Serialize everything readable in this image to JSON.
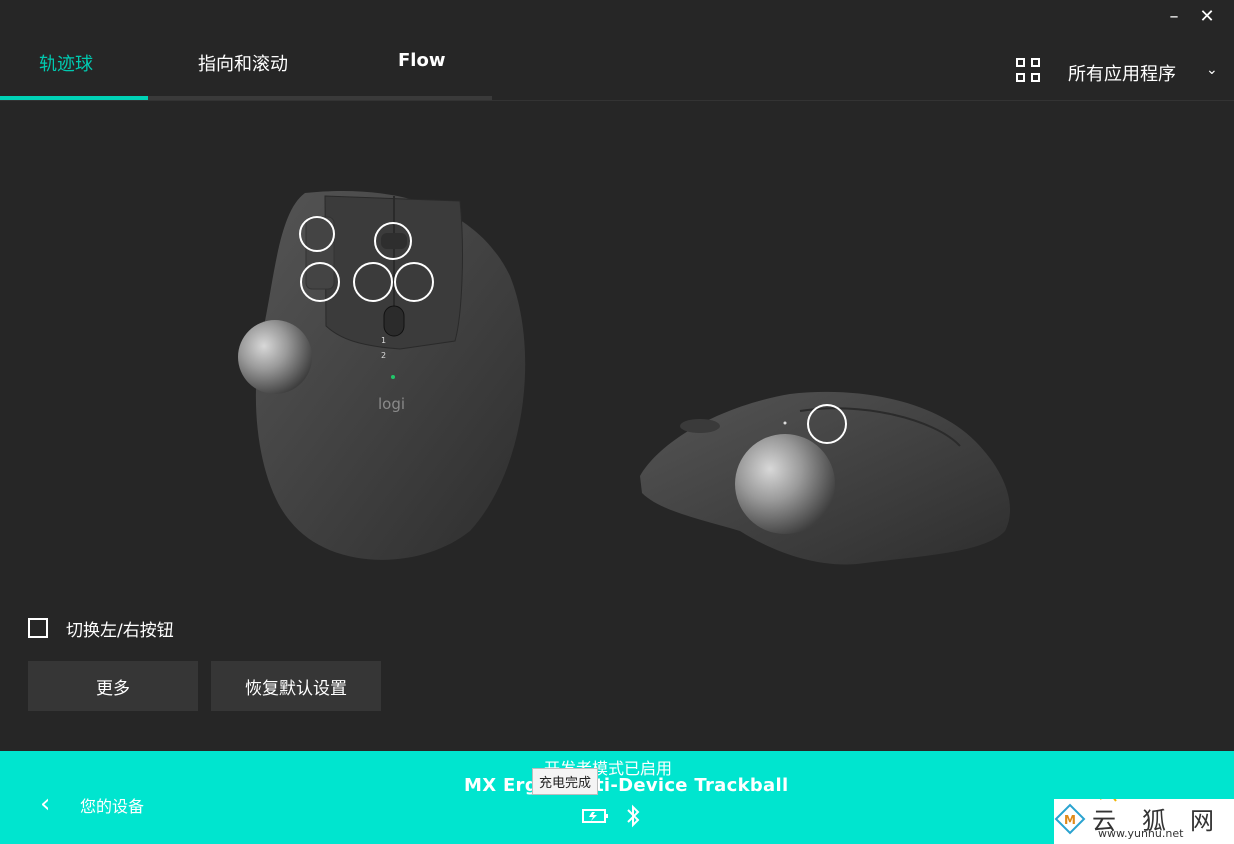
{
  "window": {
    "minimize": "–",
    "close": "✕"
  },
  "tabs": [
    {
      "label": "轨迹球"
    },
    {
      "label": "指向和滚动"
    },
    {
      "label": "Flow"
    }
  ],
  "app_selector": {
    "label": "所有应用程序"
  },
  "device_image": {
    "brand": "logi",
    "mode_numbers": [
      "1",
      "2"
    ]
  },
  "options": {
    "swap_buttons_label": "切换左/右按钮",
    "swap_buttons_checked": false
  },
  "buttons": {
    "more": "更多",
    "restore_defaults": "恢复默认设置"
  },
  "footer": {
    "back_label": "您的设备",
    "dev_mode_text": "开发者模式已启用",
    "device_name": "MX Ergo Multi-Device Trackball",
    "tooltip": "充电完成"
  },
  "watermark": {
    "chars": [
      "云",
      "狐",
      "网"
    ],
    "url": "www.yunhu.net"
  },
  "colors": {
    "accent": "#00d2b6",
    "footer_bg": "#00e5cf",
    "background": "#262626",
    "button_bg": "#363636"
  }
}
